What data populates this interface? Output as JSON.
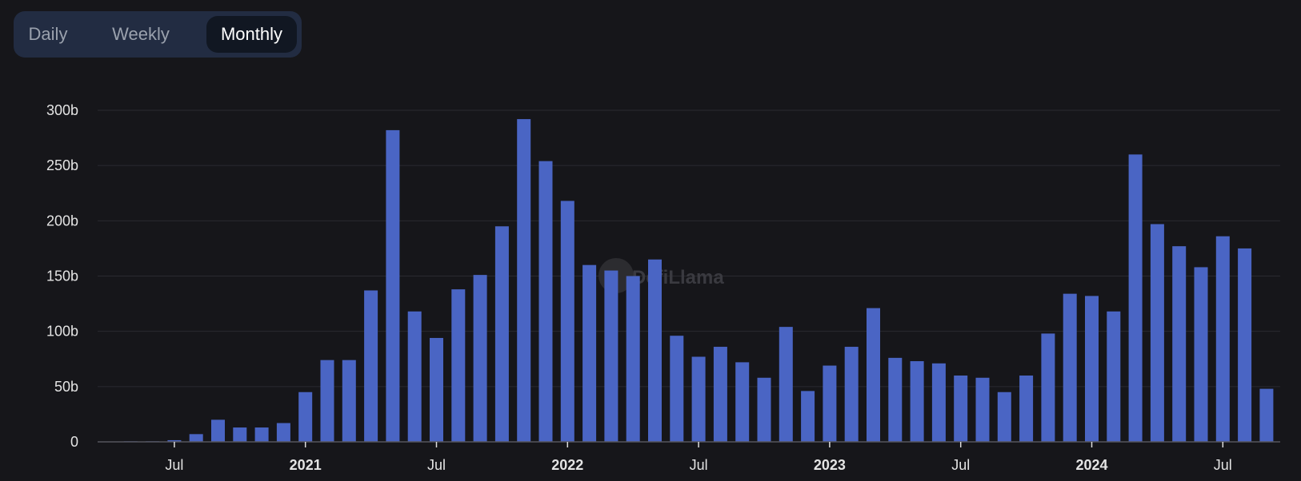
{
  "toggle": {
    "options": [
      "Daily",
      "Weekly",
      "Monthly"
    ],
    "selected": "Monthly"
  },
  "watermark": "DefiLlama",
  "chart_data": {
    "type": "bar",
    "title": "",
    "xlabel": "",
    "ylabel": "",
    "ylim": [
      0,
      300
    ],
    "yticks": [
      {
        "value": 0,
        "label": "0"
      },
      {
        "value": 50,
        "label": "50b"
      },
      {
        "value": 100,
        "label": "100b"
      },
      {
        "value": 150,
        "label": "150b"
      },
      {
        "value": 200,
        "label": "200b"
      },
      {
        "value": 250,
        "label": "250b"
      },
      {
        "value": 300,
        "label": "300b"
      }
    ],
    "xticks": [
      {
        "index": 3,
        "label": "Jul",
        "year": false
      },
      {
        "index": 9,
        "label": "2021",
        "year": true
      },
      {
        "index": 15,
        "label": "Jul",
        "year": false
      },
      {
        "index": 21,
        "label": "2022",
        "year": true
      },
      {
        "index": 27,
        "label": "Jul",
        "year": false
      },
      {
        "index": 33,
        "label": "2023",
        "year": true
      },
      {
        "index": 39,
        "label": "Jul",
        "year": false
      },
      {
        "index": 45,
        "label": "2024",
        "year": true
      },
      {
        "index": 51,
        "label": "Jul",
        "year": false
      }
    ],
    "grid": true,
    "bar_color": "#4a65c4",
    "categories": [
      "2020-04",
      "2020-05",
      "2020-06",
      "2020-07",
      "2020-08",
      "2020-09",
      "2020-10",
      "2020-11",
      "2020-12",
      "2021-01",
      "2021-02",
      "2021-03",
      "2021-04",
      "2021-05",
      "2021-06",
      "2021-07",
      "2021-08",
      "2021-09",
      "2021-10",
      "2021-11",
      "2021-12",
      "2022-01",
      "2022-02",
      "2022-03",
      "2022-04",
      "2022-05",
      "2022-06",
      "2022-07",
      "2022-08",
      "2022-09",
      "2022-10",
      "2022-11",
      "2022-12",
      "2023-01",
      "2023-02",
      "2023-03",
      "2023-04",
      "2023-05",
      "2023-06",
      "2023-07",
      "2023-08",
      "2023-09",
      "2023-10",
      "2023-11",
      "2023-12",
      "2024-01",
      "2024-02",
      "2024-03",
      "2024-04",
      "2024-05",
      "2024-06",
      "2024-07",
      "2024-08",
      "2024-09"
    ],
    "values": [
      0.3,
      0.5,
      0.5,
      1.5,
      7,
      20,
      13,
      13,
      17,
      45,
      74,
      74,
      137,
      282,
      118,
      94,
      138,
      151,
      195,
      292,
      254,
      218,
      160,
      155,
      150,
      165,
      96,
      77,
      86,
      72,
      58,
      104,
      46,
      69,
      86,
      121,
      76,
      73,
      71,
      60,
      58,
      45,
      60,
      98,
      134,
      132,
      118,
      260,
      197,
      177,
      158,
      186,
      175,
      48
    ],
    "unit": "b"
  }
}
